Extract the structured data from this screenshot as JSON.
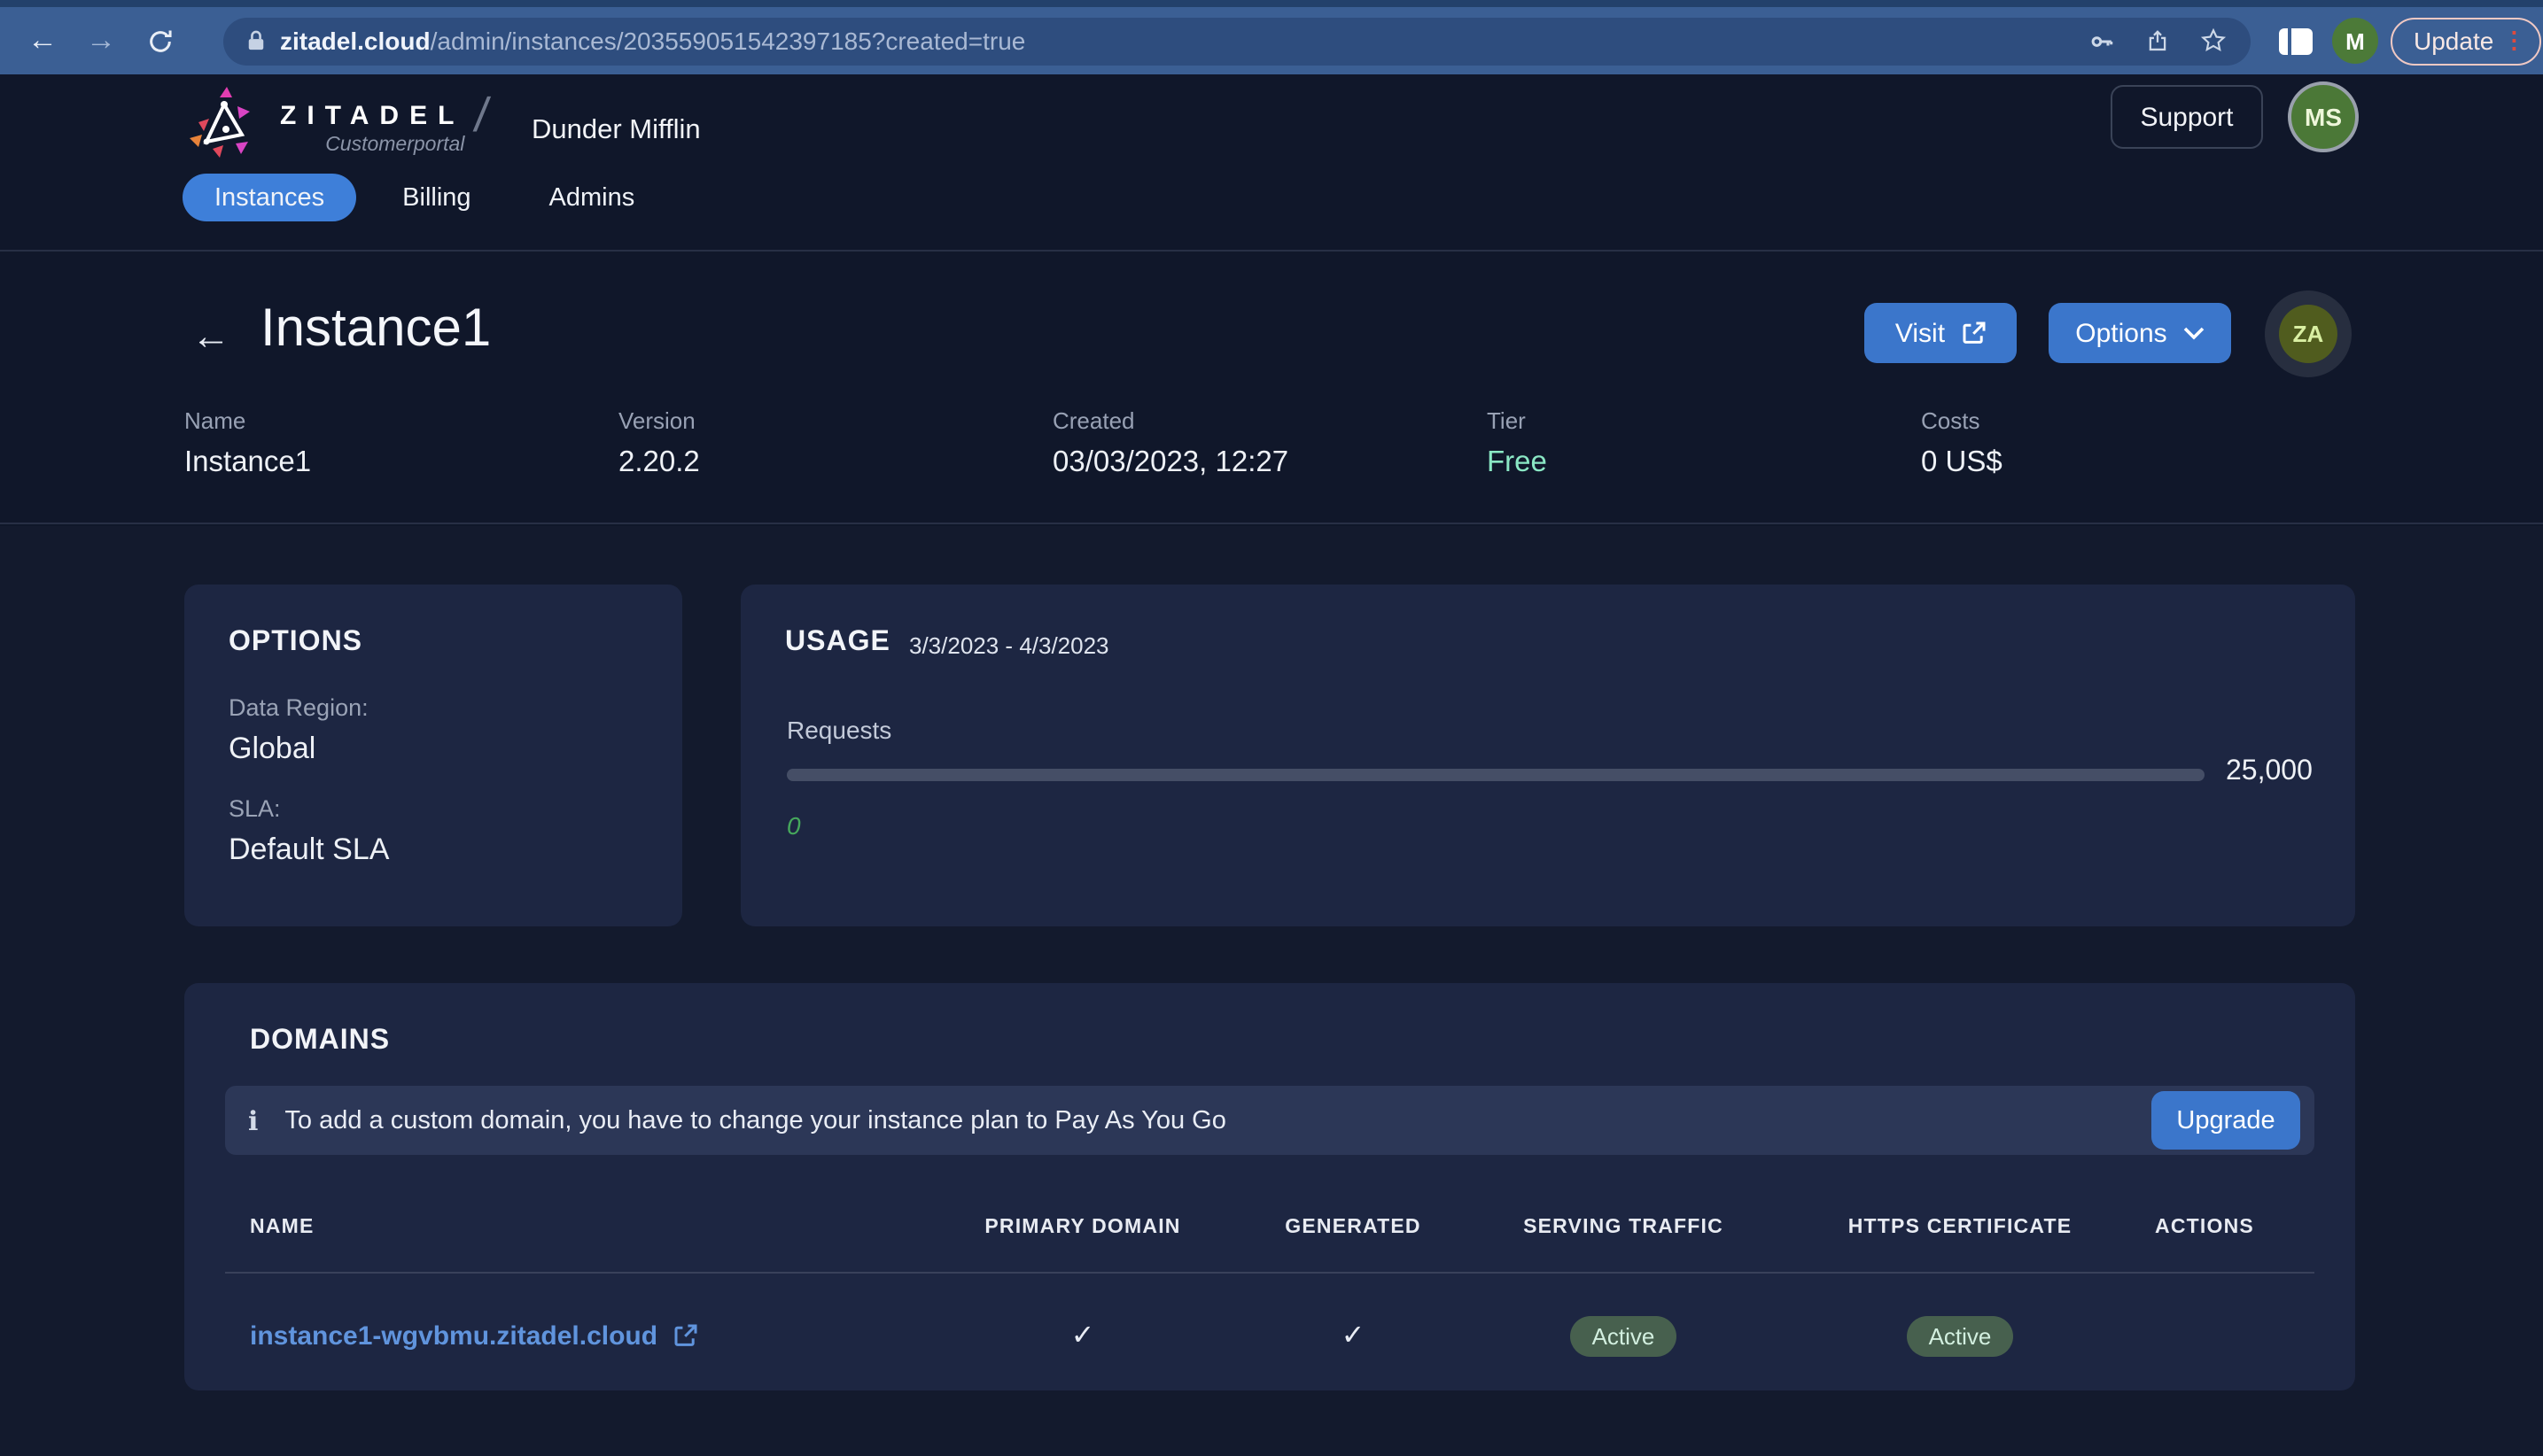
{
  "icons": {
    "check": "✓",
    "info": "ℹ",
    "back_arrow": "←",
    "forward_arrow": "→",
    "kebab": "⋮",
    "slash": "/"
  },
  "colors": {
    "accent_blue": "#3b76cb",
    "tab_blue": "#3e7fd9",
    "link_blue": "#6094dd",
    "tier_green": "#8ae7c4",
    "usage_green": "#46a85c",
    "badge_bg": "#47604e",
    "badge_text": "#d2efdf"
  },
  "browser": {
    "url_host": "zitadel.cloud",
    "url_path": "/admin/instances/203559051542397185?created=true",
    "profile_initial": "M",
    "update_label": "Update"
  },
  "header": {
    "brand": "ZITADEL",
    "brand_sub": "Customerportal",
    "org": "Dunder Mifflin",
    "support_label": "Support",
    "avatar_initials": "MS",
    "tabs": [
      {
        "label": "Instances",
        "active": true
      },
      {
        "label": "Billing",
        "active": false
      },
      {
        "label": "Admins",
        "active": false
      }
    ]
  },
  "instance": {
    "title": "Instance1",
    "visit_label": "Visit",
    "options_label": "Options",
    "avatar_initials": "ZA",
    "meta": [
      {
        "label": "Name",
        "value": "Instance1"
      },
      {
        "label": "Version",
        "value": "2.20.2"
      },
      {
        "label": "Created",
        "value": "03/03/2023, 12:27"
      },
      {
        "label": "Tier",
        "value": "Free"
      },
      {
        "label": "Costs",
        "value": "0 US$"
      }
    ]
  },
  "options_card": {
    "title": "OPTIONS",
    "fields": [
      {
        "label": "Data Region:",
        "value": "Global"
      },
      {
        "label": "SLA:",
        "value": "Default SLA"
      }
    ]
  },
  "usage_card": {
    "title": "USAGE",
    "period": "3/3/2023 - 4/3/2023",
    "metric_label": "Requests",
    "used": "0",
    "limit": "25,000",
    "percent_used": 0
  },
  "domains_card": {
    "title": "DOMAINS",
    "banner_text": "To add a custom domain, you have to change your instance plan to Pay As You Go",
    "upgrade_label": "Upgrade",
    "table": {
      "headers": [
        "NAME",
        "PRIMARY DOMAIN",
        "GENERATED",
        "SERVING TRAFFIC",
        "HTTPS CERTIFICATE",
        "ACTIONS"
      ],
      "rows": [
        {
          "name": "instance1-wgvbmu.zitadel.cloud",
          "primary_domain": true,
          "generated": true,
          "serving_traffic": "Active",
          "https_certificate": "Active"
        }
      ]
    }
  }
}
